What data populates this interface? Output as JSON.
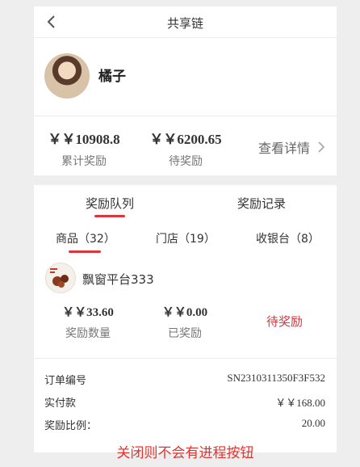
{
  "header": {
    "title": "共享链",
    "back_icon": "chevron-left-icon"
  },
  "user": {
    "name": "橘子"
  },
  "stats": {
    "total_value": "￥￥10908.8",
    "total_label": "累计奖励",
    "pending_value": "￥￥6200.65",
    "pending_label": "待奖励",
    "details_label": "查看详情"
  },
  "tabs": {
    "queue": "奖励队列",
    "records": "奖励记录"
  },
  "subtabs": {
    "goods": "商品（32）",
    "stores": "门店（19）",
    "cashier": "收银台（8）"
  },
  "product": {
    "name": "飘窗平台333",
    "count_value": "￥￥33.60",
    "count_label": "奖励数量",
    "paid_value": "￥￥0.00",
    "paid_label": "已奖励",
    "status": "待奖励"
  },
  "order": {
    "order_no_label": "订单编号",
    "order_no": "SN2310311350F3F532",
    "paid_label": "实付款",
    "paid_value": "￥￥168.00",
    "ratio_label": "奖励比例：",
    "ratio_value": "20.00"
  },
  "notice": "关闭则不会有进程按钮",
  "colors": {
    "accent": "#d9363e",
    "notice": "#e5322d"
  }
}
